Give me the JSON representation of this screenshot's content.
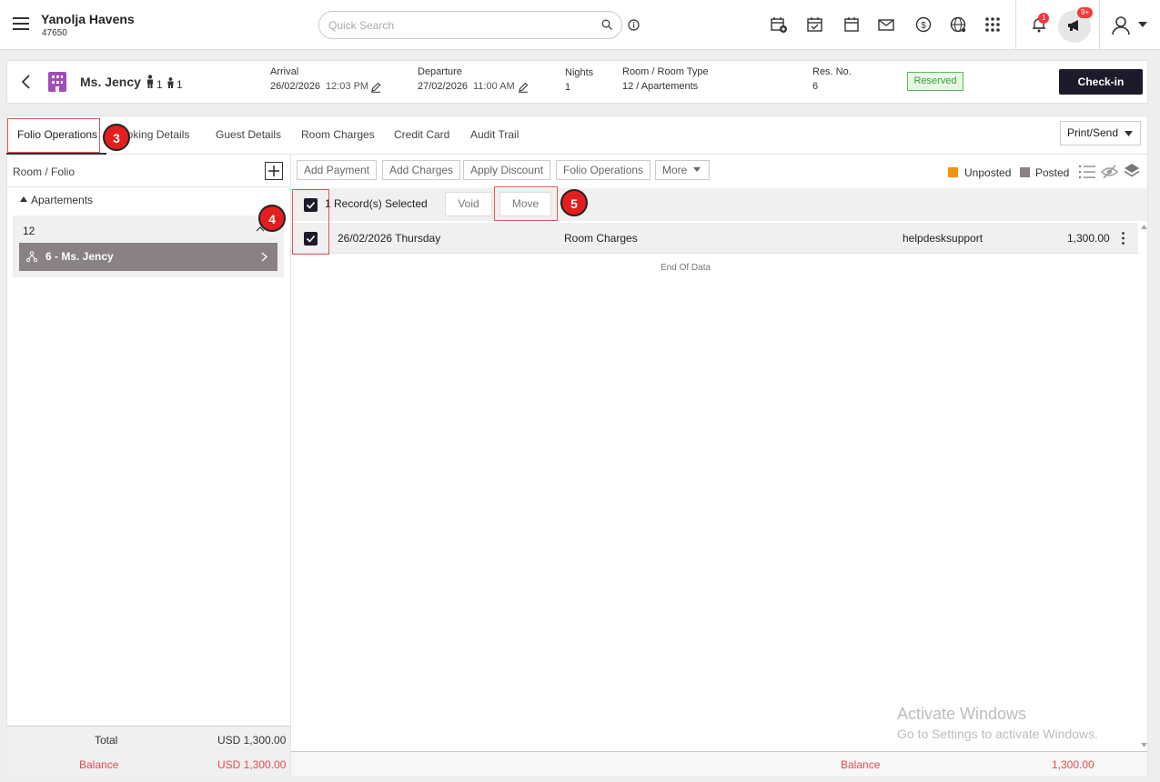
{
  "app": {
    "hotel_name": "Yanolja Havens",
    "hotel_id": "47650",
    "search_placeholder": "Quick Search",
    "notification_count": "1",
    "announcement_count": "9+"
  },
  "reservation": {
    "guest_name": "Ms. Jency",
    "adults": "1",
    "children": "1",
    "arrival_label": "Arrival",
    "arrival_date": "26/02/2026",
    "arrival_time": "12:03 PM",
    "departure_label": "Departure",
    "departure_date": "27/02/2026",
    "departure_time": "11:00 AM",
    "nights_label": "Nights",
    "nights": "1",
    "room_label": "Room / Room Type",
    "room_value": "12 / Apartements",
    "resno_label": "Res. No.",
    "resno": "6",
    "status": "Reserved",
    "checkin_label": "Check-in"
  },
  "tabs": [
    {
      "label": "Folio Operations"
    },
    {
      "label": "Booking Details"
    },
    {
      "label": "Guest Details"
    },
    {
      "label": "Room Charges"
    },
    {
      "label": "Credit Card"
    },
    {
      "label": "Audit Trail"
    }
  ],
  "print_send_label": "Print/Send",
  "left_pane": {
    "title": "Room / Folio",
    "group": "Apartements",
    "room_number": "12",
    "folio_label": "6 - Ms. Jency",
    "total_label": "Total",
    "total_value": "USD 1,300.00",
    "balance_label": "Balance",
    "balance_value": "USD 1,300.00"
  },
  "toolbar": {
    "add_payment": "Add Payment",
    "add_charges": "Add Charges",
    "apply_discount": "Apply Discount",
    "folio_operations": "Folio Operations",
    "more": "More",
    "unposted": "Unposted",
    "posted": "Posted"
  },
  "selection": {
    "count_text": "1 Record(s) Selected",
    "void_label": "Void",
    "move_label": "Move"
  },
  "rows": [
    {
      "date": "26/02/2026 Thursday",
      "description": "Room Charges",
      "user": "helpdesksupport",
      "amount": "1,300.00"
    }
  ],
  "end_of_data": "End Of Data",
  "right_footer": {
    "balance_label": "Balance",
    "balance_value": "1,300.00"
  },
  "steps": {
    "s3": "3",
    "s4": "4",
    "s5": "5"
  },
  "watermark": {
    "line1": "Activate Windows",
    "line2": "Go to Settings to activate Windows."
  },
  "colors": {
    "unposted": "#f0930e",
    "posted": "#8a8282",
    "annotation": "#e31e1e"
  }
}
